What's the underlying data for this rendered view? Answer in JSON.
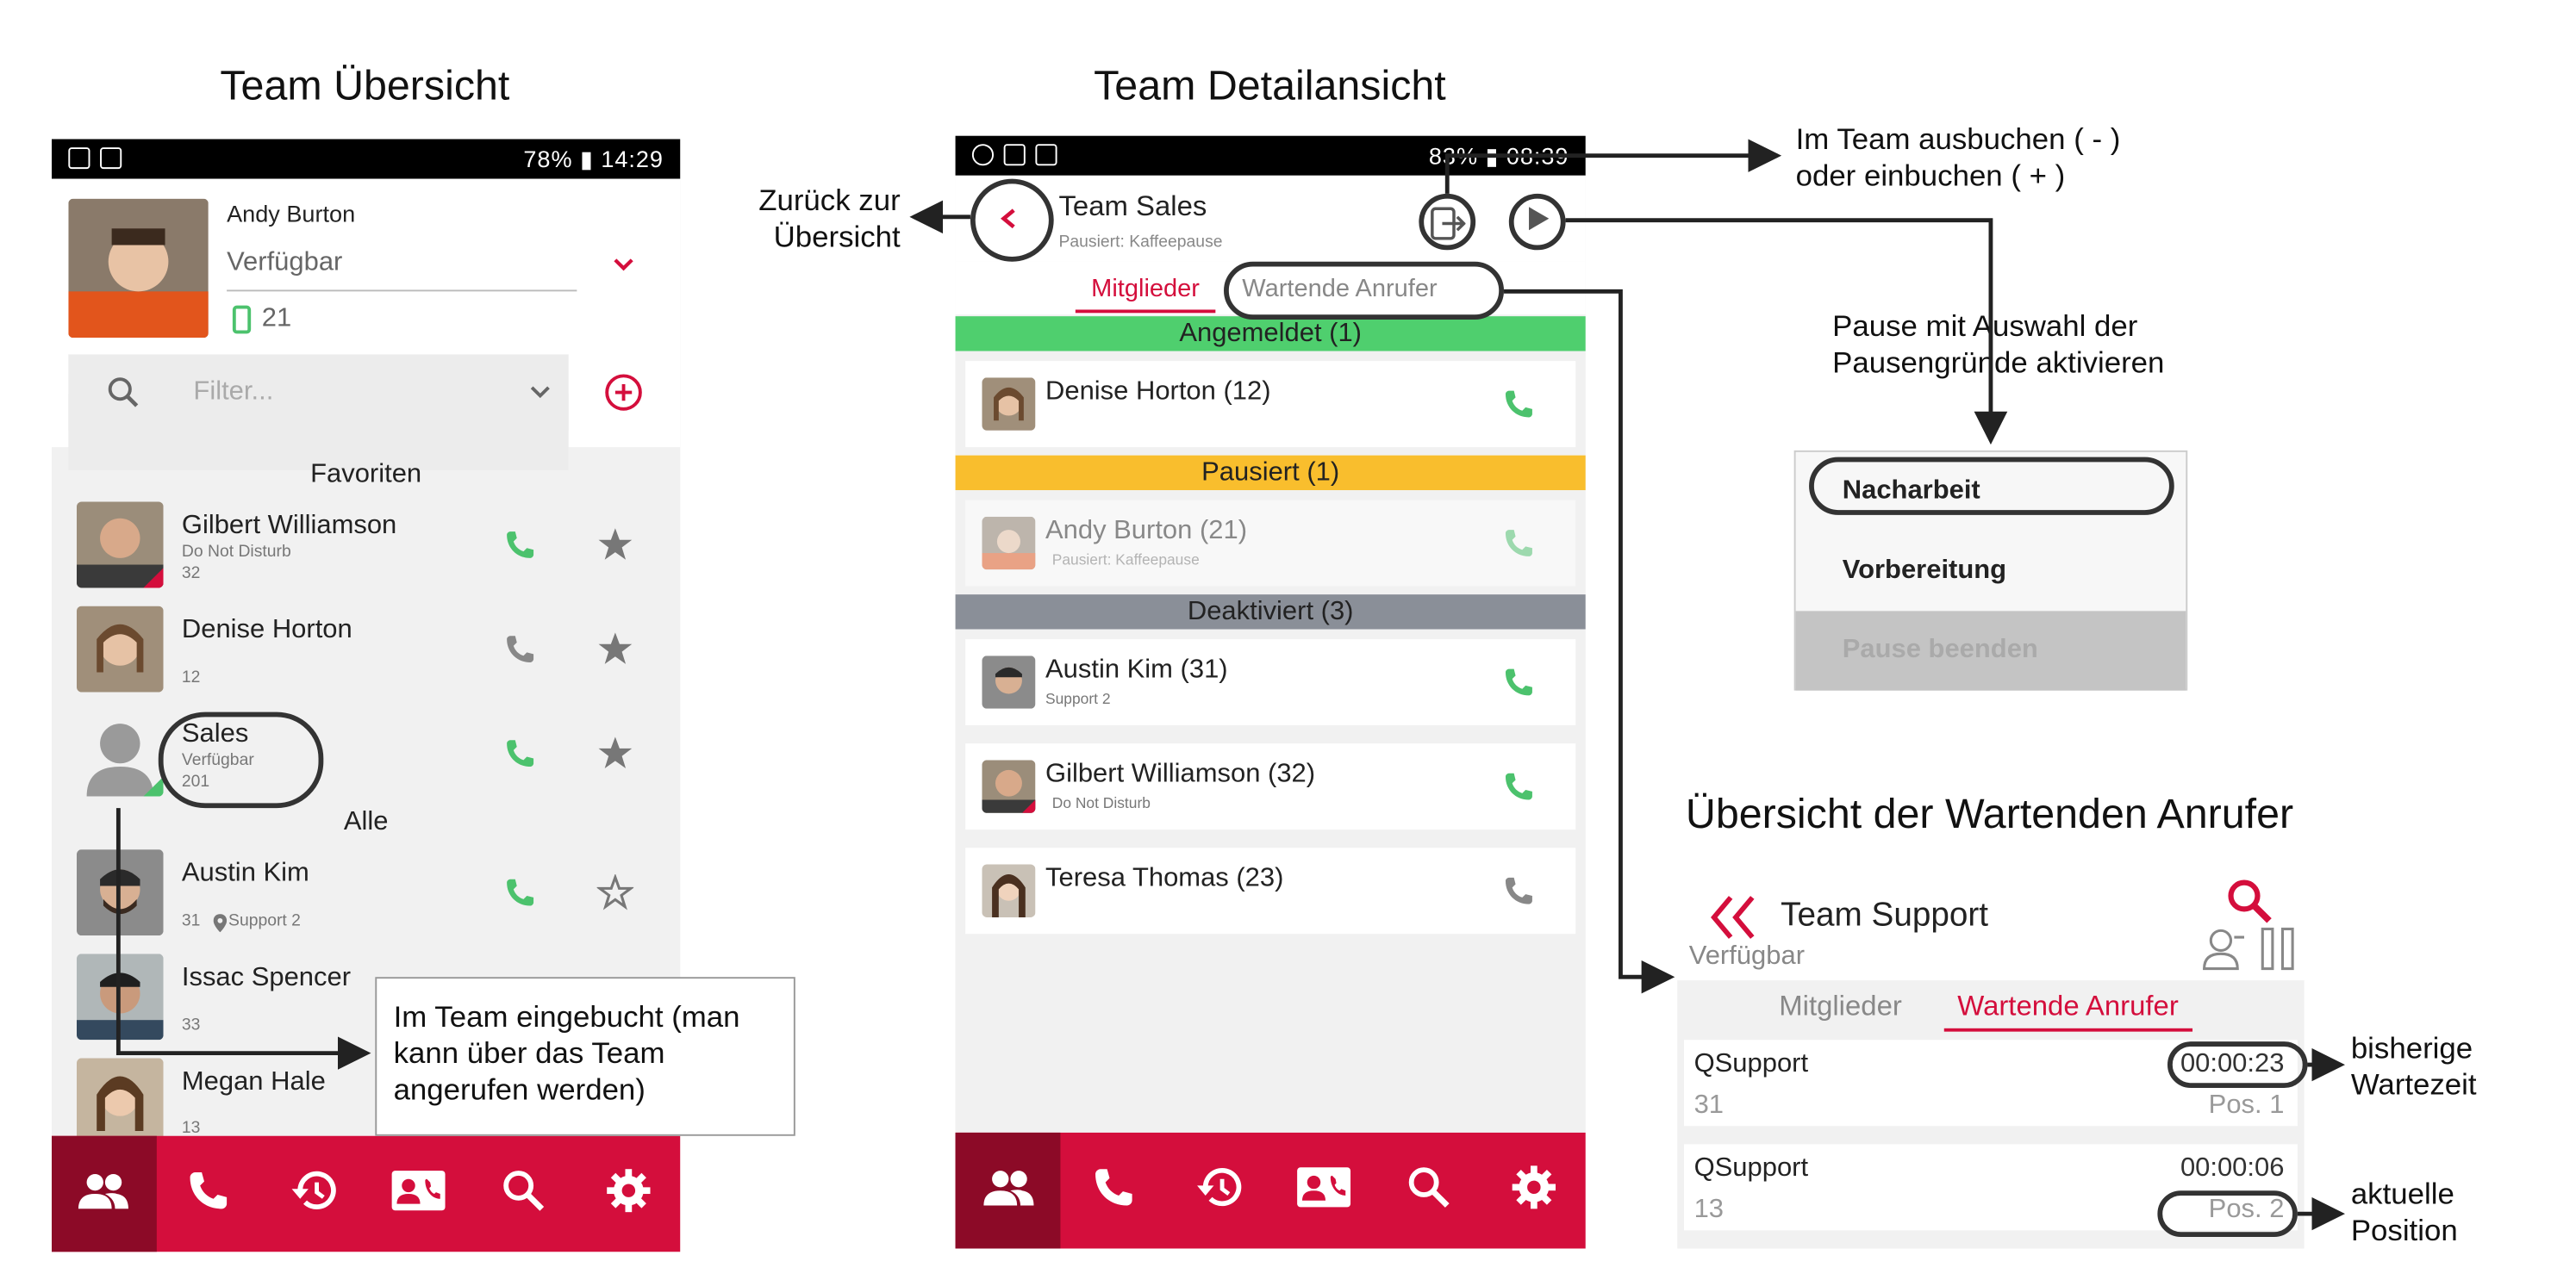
{
  "titles": {
    "overview": "Team Übersicht",
    "detail": "Team Detailansicht",
    "waiting": "Übersicht der Wartenden Anrufer"
  },
  "statusbar_left": {
    "right_text": "78% ▮ 14:29"
  },
  "statusbar_mid": {
    "right_text": "83% ▮ 08:39"
  },
  "overview": {
    "user_name": "Andy Burton",
    "status": "Verfügbar",
    "extension": "21",
    "filter_placeholder": "Filter...",
    "section_favorites": "Favoriten",
    "section_all": "Alle",
    "favorites": [
      {
        "name": "Gilbert Williamson",
        "sub": "Do Not Disturb",
        "num": "32"
      },
      {
        "name": "Denise Horton",
        "sub": "",
        "num": "12"
      },
      {
        "name": "Sales",
        "sub": "Verfügbar",
        "num": "201"
      }
    ],
    "all": [
      {
        "name": "Austin Kim",
        "sub": "Support 2",
        "num": "31"
      },
      {
        "name": "Issac Spencer",
        "sub": "",
        "num": "33"
      },
      {
        "name": "Megan Hale",
        "sub": "",
        "num": "13"
      }
    ]
  },
  "detail": {
    "team_name": "Team Sales",
    "team_status": "Pausiert: Kaffeepause",
    "tab_members": "Mitglieder",
    "tab_waiting": "Wartende Anrufer",
    "band_logged_in": "Angemeldet (1)",
    "band_paused": "Pausiert (1)",
    "band_disabled": "Deaktiviert (3)",
    "members": [
      {
        "name": "Denise Horton (12)",
        "sub": ""
      },
      {
        "name": "Andy Burton (21)",
        "sub": "Pausiert: Kaffeepause"
      },
      {
        "name": "Austin Kim (31)",
        "sub": "Support 2"
      },
      {
        "name": "Gilbert Williamson (32)",
        "sub": "Do Not Disturb"
      },
      {
        "name": "Teresa Thomas (23)",
        "sub": ""
      }
    ]
  },
  "pause_menu": {
    "items": [
      "Nacharbeit",
      "Vorbereitung",
      "Pause beenden"
    ]
  },
  "waiting": {
    "team_name": "Team Support",
    "team_status": "Verfügbar",
    "tab_members": "Mitglieder",
    "tab_waiting": "Wartende Anrufer",
    "callers": [
      {
        "queue": "QSupport",
        "time": "00:00:23",
        "num": "31",
        "pos": "Pos. 1"
      },
      {
        "queue": "QSupport",
        "time": "00:00:06",
        "num": "13",
        "pos": "Pos. 2"
      }
    ]
  },
  "annotations": {
    "back": "Zurück zur\nÜbersicht",
    "logout": "Im Team ausbuchen ( - )\noder einbuchen ( + )",
    "pause": "Pause mit Auswahl der\nPausengründe aktivieren",
    "booked_in": "Im Team eingebucht (man\nkann über das Team\nangerufen werden)",
    "wait_time": "bisherige\nWartezeit",
    "position": "aktuelle\nPosition"
  },
  "colors": {
    "brand_red": "#d40e3c",
    "call_green": "#4cc26d",
    "band_green": "#4fcf6e",
    "band_yellow": "#f9be2d",
    "band_gray": "#8a8f98"
  }
}
